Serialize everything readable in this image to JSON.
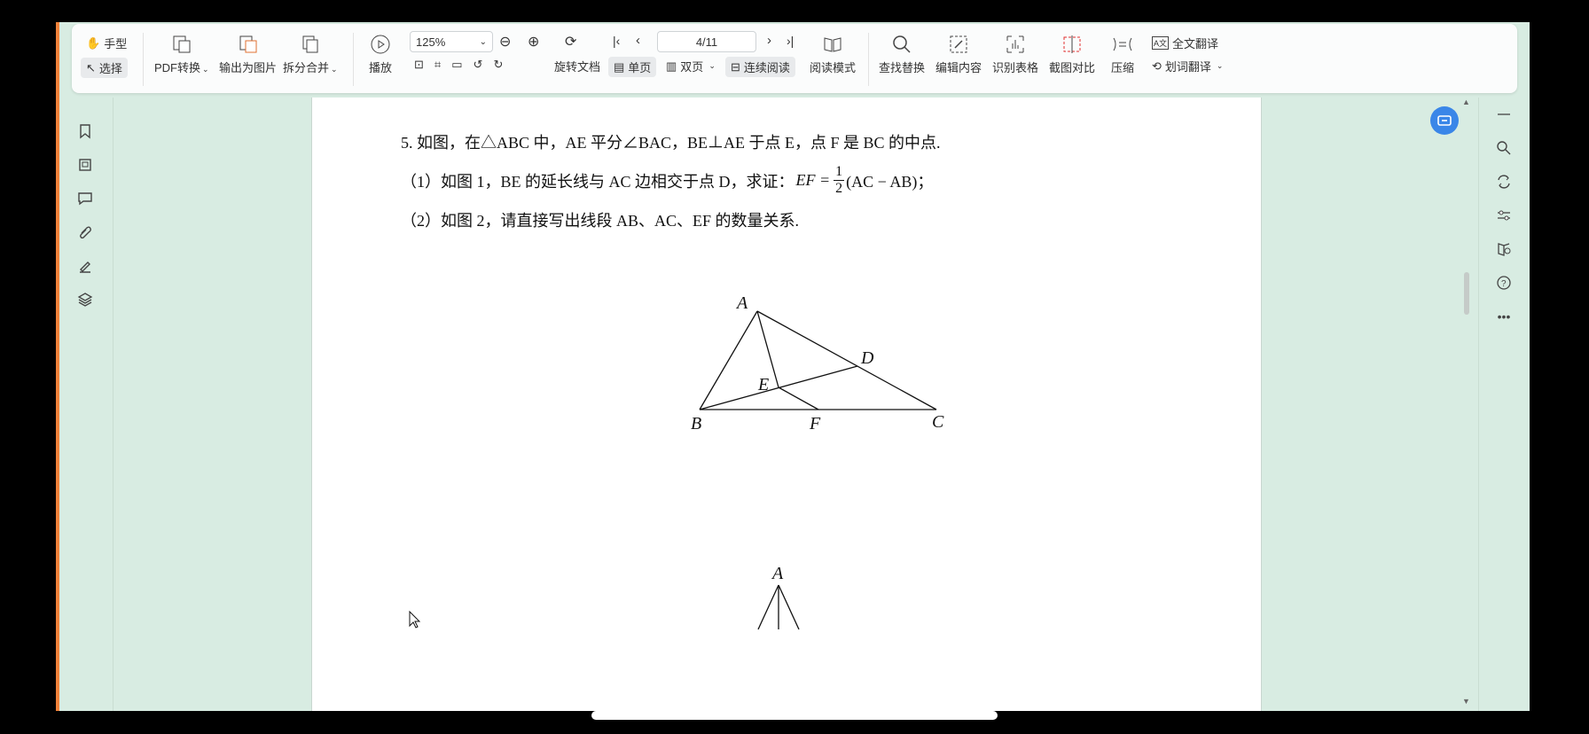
{
  "toolbar": {
    "hand": "手型",
    "select": "选择",
    "pdf_convert": "PDF转换",
    "export_image": "输出为图片",
    "split_merge": "拆分合并",
    "play": "播放",
    "zoom": "125%",
    "page_indicator": "4/11",
    "rotate_doc": "旋转文档",
    "single_page": "单页",
    "double_page": "双页",
    "continuous": "连续阅读",
    "reading_mode": "阅读模式",
    "find_replace": "查找替换",
    "edit_content": "编辑内容",
    "recognize_table": "识别表格",
    "screenshot_compare": "截图对比",
    "compress": "压缩",
    "full_translate": "全文翻译",
    "word_translate": "划词翻译"
  },
  "document": {
    "q_num": "5.",
    "q_line1": "如图，在△ABC 中，AE 平分∠BAC，BE⊥AE 于点 E，点 F 是 BC 的中点.",
    "q_line2_a": "（1）如图 1，BE 的延长线与 AC 边相交于点 D，求证：",
    "q_line2_b": "EF =",
    "frac_num": "1",
    "frac_den": "2",
    "q_line2_c": "(AC − AB)；",
    "q_line3": "（2）如图 2，请直接写出线段 AB、AC、EF 的数量关系.",
    "fig1_labels": {
      "A": "A",
      "B": "B",
      "C": "C",
      "D": "D",
      "E": "E",
      "F": "F"
    },
    "fig2_labels": {
      "A": "A"
    }
  },
  "colors": {
    "accent": "#f0823a",
    "background": "#d8ece2",
    "fab": "#3a86e8"
  }
}
